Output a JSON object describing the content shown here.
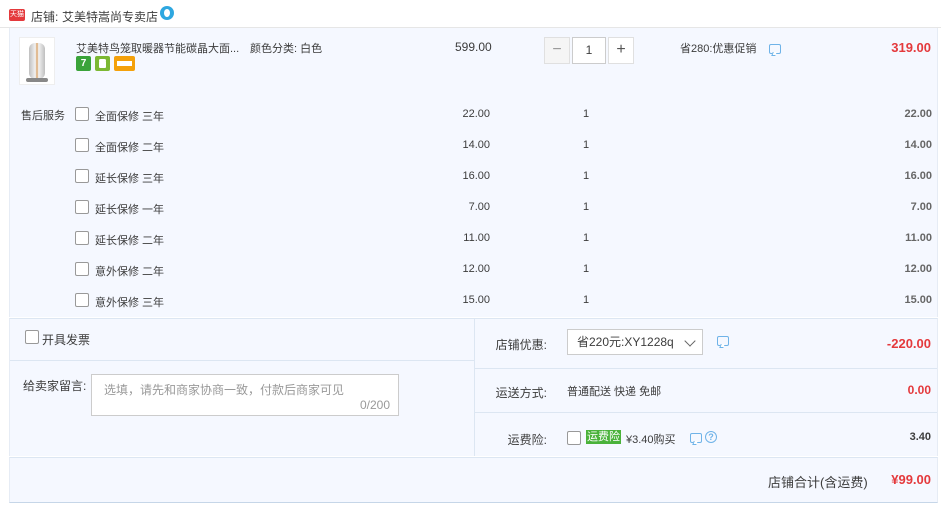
{
  "shop": {
    "badge_text": "天猫",
    "prefix": "店铺:",
    "name": "艾美特嵩尚专卖店"
  },
  "product": {
    "title": "艾美特鸟笼取暖器节能碳晶大面...",
    "sku": "颜色分类: 白色",
    "price": "599.00",
    "quantity": "1",
    "qty_minus": "−",
    "qty_plus": "+",
    "promo": "省280:优惠促销",
    "total": "319.00",
    "icons": [
      "seven-day-return-icon",
      "android-icon",
      "card-icon"
    ],
    "seven_label": "7"
  },
  "services": {
    "label": "售后服务",
    "items": [
      {
        "name": "全面保修 三年",
        "price": "22.00",
        "qty": "1",
        "total": "22.00"
      },
      {
        "name": "全面保修 二年",
        "price": "14.00",
        "qty": "1",
        "total": "14.00"
      },
      {
        "name": "延长保修 三年",
        "price": "16.00",
        "qty": "1",
        "total": "16.00"
      },
      {
        "name": "延长保修 一年",
        "price": "7.00",
        "qty": "1",
        "total": "7.00"
      },
      {
        "name": "延长保修 二年",
        "price": "11.00",
        "qty": "1",
        "total": "11.00"
      },
      {
        "name": "意外保修 二年",
        "price": "12.00",
        "qty": "1",
        "total": "12.00"
      },
      {
        "name": "意外保修 三年",
        "price": "15.00",
        "qty": "1",
        "total": "15.00"
      }
    ]
  },
  "invoice": {
    "label": "开具发票"
  },
  "memo": {
    "label": "给卖家留言:",
    "placeholder": "选填，请先和商家协商一致，付款后商家可见",
    "count": "0/200"
  },
  "coupon": {
    "label": "店铺优惠:",
    "selected": "省220元:XY1228q",
    "value": "-220.00"
  },
  "shipping": {
    "label": "运送方式:",
    "method": "普通配送 快递 免邮",
    "value": "0.00"
  },
  "insurance": {
    "label": "运费险:",
    "badge": "运费险",
    "price_text": "¥3.40购买",
    "help": "?",
    "value": "3.40"
  },
  "summary": {
    "label": "店铺合计(含运费)",
    "value": "¥99.00"
  },
  "colors": {
    "accent_red": "#e4393c",
    "panel_bg": "#f5f8ff",
    "link_blue": "#6fb3e8",
    "insurance_green": "#4ab23a"
  }
}
